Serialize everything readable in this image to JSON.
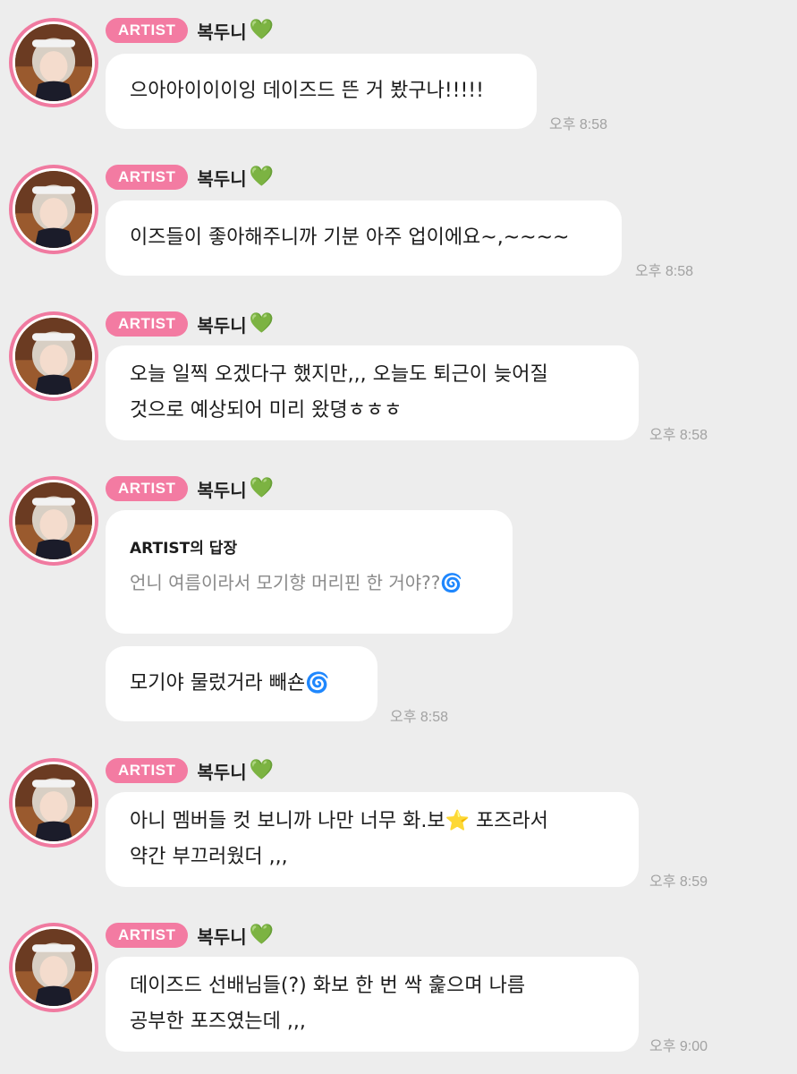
{
  "badge_label": "ARTIST",
  "sender_name": "복두니",
  "heart_emoji": "💚",
  "messages": [
    {
      "lines": [
        "으아아이이이잉 데이즈드 뜬 거 봤구나!!!!!"
      ],
      "time": "오후 8:58"
    },
    {
      "lines": [
        "이즈들이 좋아해주니까 기분 아주 업이에요~,~~~~"
      ],
      "time": "오후 8:58"
    },
    {
      "lines": [
        "오늘 일찍 오겠다구 했지만,,, 오늘도 퇴근이 늦어질",
        "것으로 예상되어 미리 왔뎡ㅎㅎㅎ"
      ],
      "time": "오후 8:58"
    },
    {
      "reply_title": "ARTIST의 답장",
      "reply_quote": "언니 여름이라서 모기향 머리핀 한 거야??🌀",
      "lines": [
        "모기야 물렀거라 빼숀🌀"
      ],
      "time": "오후 8:58"
    },
    {
      "lines": [
        "아니 멤버들 컷 보니까 나만 너무 화.보⭐ 포즈라서",
        "약간 부끄러웠더 ,,,"
      ],
      "time": "오후 8:59"
    },
    {
      "lines": [
        "데이즈드 선배님들(?) 화보 한 번 싹 훑으며 나름",
        "공부한 포즈였는데 ,,,"
      ],
      "time": "오후 9:00"
    }
  ],
  "colors": {
    "background": "#ededed",
    "badge": "#f37ba2",
    "avatar_ring": "#f07aa0",
    "bubble": "#ffffff",
    "time_text": "#a2a2a2",
    "quote_text": "#8a8a8a"
  }
}
